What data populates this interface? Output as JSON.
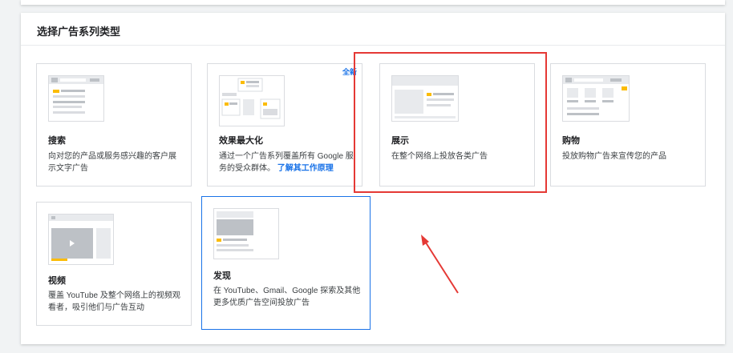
{
  "panel": {
    "title": "选择广告系列类型"
  },
  "cards": [
    {
      "name": "搜索",
      "desc": "向对您的产品或服务感兴趣的客户展示文字广告"
    },
    {
      "name": "效果最大化",
      "desc": "通过一个广告系列覆盖所有 Google 服务的受众群体。",
      "link": "了解其工作原理",
      "badge": "全新"
    },
    {
      "name": "展示",
      "desc": "在整个网络上投放各类广告"
    },
    {
      "name": "购物",
      "desc": "投放购物广告来宣传您的产品"
    },
    {
      "name": "视频",
      "desc": "覆盖 YouTube 及整个网络上的视频观看者，吸引他们与广告互动"
    },
    {
      "name": "发现",
      "desc": "在 YouTube、Gmail、Google 探索及其他更多优质广告空间投放广告"
    }
  ],
  "colors": {
    "accent": "#1a73e8",
    "yellow": "#fbbc04",
    "annotation": "#e53935"
  },
  "icons": [
    "search-ad-illustration",
    "performance-max-illustration",
    "display-ad-illustration",
    "shopping-ad-illustration",
    "video-ad-illustration",
    "discovery-ad-illustration"
  ]
}
